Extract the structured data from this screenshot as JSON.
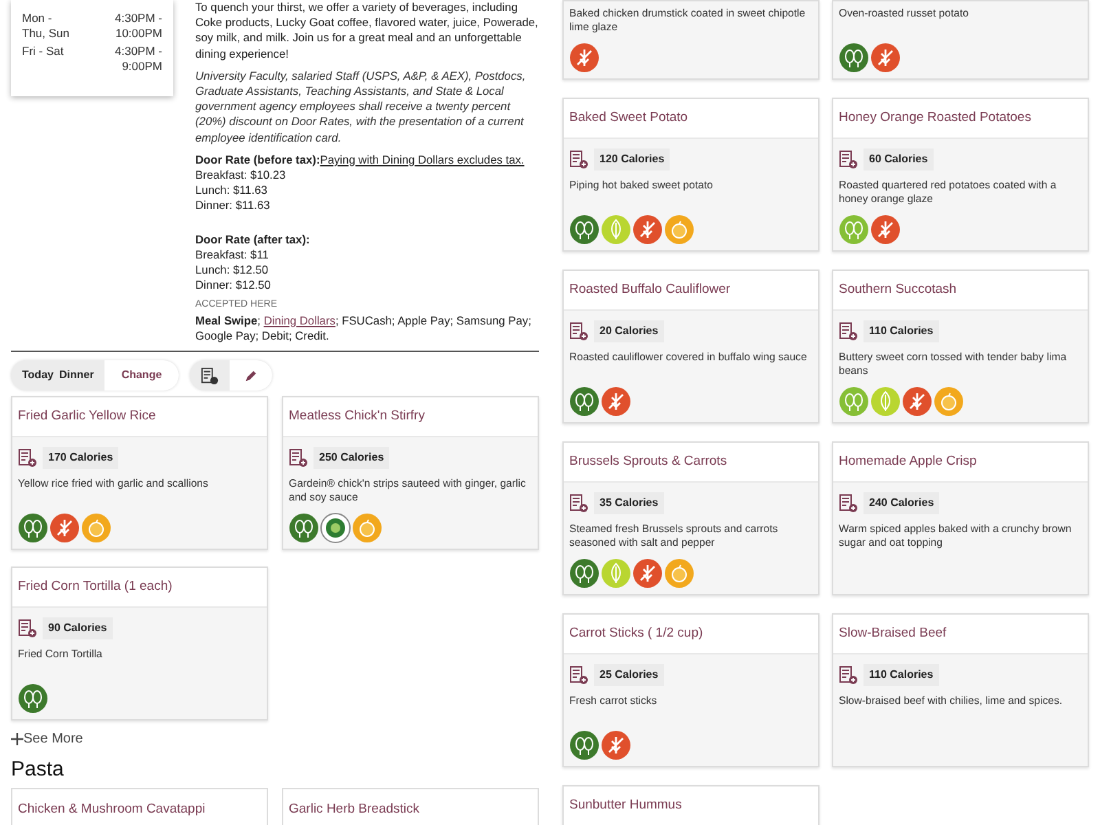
{
  "hours": [
    {
      "days": "Mon - Thu, Sun",
      "time": "4:30PM - 10:00PM"
    },
    {
      "days": "Fri - Sat",
      "time": "4:30PM - 9:00PM"
    }
  ],
  "about": {
    "intro": "To quench your thirst, we offer a variety of beverages, including Coke products, Lucky Goat coffee, flavored water, juice, Powerade, soy milk, and milk. Join us for a great meal and an unforgettable dining experience!",
    "discount": "University Faculty, salaried Staff (USPS, A&P, & AEX), Postdocs, Graduate Assistants, Teaching Assistants, and State & Local government agency employees shall receive a twenty percent (20%) discount on Door Rates, with the presentation of a current employee identification card.",
    "rates": [
      {
        "label": "Door Rate (before tax):",
        "link": "Paying with Dining Dollars excludes tax.",
        "lines": [
          "Breakfast: $10.23",
          "Lunch: $11.63",
          "Dinner: $11.63"
        ]
      },
      {
        "label": "Door Rate (after tax):",
        "lines": [
          "Breakfast: $11",
          "Lunch: $12.50",
          "Dinner: $12.50"
        ]
      }
    ],
    "accepted_heading": "ACCEPTED HERE",
    "accepted": {
      "prefix": "**Meal Swipe**; ",
      "link": "Dining Dollars",
      "suffix": "; FSUCash; Apple Pay; Samsung Pay; Google Pay; Debit; Credit."
    }
  },
  "toolbar": {
    "day": "Today",
    "meal": "Dinner",
    "change": "Change"
  },
  "left_items": [
    {
      "title": "Fried Garlic Yellow Rice",
      "calories": "170 Calories",
      "description": "Yellow rice fried with garlic and scallions",
      "badges": [
        {
          "kind": "vegan"
        },
        {
          "kind": "gluten-free"
        },
        {
          "kind": "fruit"
        }
      ]
    },
    {
      "title": "Meatless Chick'n Stirfry",
      "calories": "250 Calories",
      "description": "Gardein® chick'n strips sauteed with ginger, garlic and soy sauce",
      "badges": [
        {
          "kind": "vegan"
        },
        {
          "kind": "certified"
        },
        {
          "kind": "fruit"
        }
      ]
    },
    {
      "title": "Fried Corn Tortilla (1 each)",
      "calories": "90 Calories",
      "description": "Fried Corn Tortilla",
      "badges": [
        {
          "kind": "vegan"
        }
      ]
    }
  ],
  "see_more": "See More",
  "next_section": {
    "heading": "Pasta",
    "items": [
      "Chicken & Mushroom Cavatappi",
      "Garlic Herb Breadstick"
    ]
  },
  "right_items": [
    {
      "description": "Baked chicken drumstick coated in sweet chipotle lime glaze",
      "badges": [
        {
          "kind": "gluten-free"
        }
      ]
    },
    {
      "description": "Oven-roasted russet potato",
      "badges": [
        {
          "kind": "vegan"
        },
        {
          "kind": "gluten-free"
        }
      ]
    },
    {
      "title": "Baked Sweet Potato",
      "calories": "120 Calories",
      "description": "Piping hot baked sweet potato",
      "badges": [
        {
          "kind": "vegan"
        },
        {
          "kind": "plant"
        },
        {
          "kind": "gluten-free"
        },
        {
          "kind": "fruit"
        }
      ]
    },
    {
      "title": "Honey Orange Roasted Potatoes",
      "calories": "60 Calories",
      "description": "Roasted quartered red potatoes coated with a honey orange glaze",
      "badges": [
        {
          "kind": "vegetarian"
        },
        {
          "kind": "gluten-free"
        }
      ]
    },
    {
      "title": "Roasted Buffalo Cauliflower",
      "calories": "20 Calories",
      "description": "Roasted cauliflower covered in buffalo wing sauce",
      "badges": [
        {
          "kind": "vegan"
        },
        {
          "kind": "gluten-free"
        }
      ]
    },
    {
      "title": "Southern Succotash",
      "calories": "110 Calories",
      "description": "Buttery sweet corn tossed with tender baby lima beans",
      "badges": [
        {
          "kind": "vegetarian"
        },
        {
          "kind": "plant"
        },
        {
          "kind": "gluten-free"
        },
        {
          "kind": "fruit"
        }
      ]
    },
    {
      "title": "Brussels Sprouts & Carrots",
      "calories": "35 Calories",
      "description": "Steamed fresh Brussels sprouts and carrots seasoned with salt and pepper",
      "badges": [
        {
          "kind": "vegan"
        },
        {
          "kind": "plant"
        },
        {
          "kind": "gluten-free"
        },
        {
          "kind": "fruit"
        }
      ]
    },
    {
      "title": "Homemade Apple Crisp",
      "calories": "240 Calories",
      "description": "Warm spiced apples baked with a crunchy brown sugar and oat topping"
    },
    {
      "title": "Carrot Sticks ( 1/2 cup)",
      "calories": "25 Calories",
      "description": "Fresh carrot sticks",
      "badges": [
        {
          "kind": "vegan"
        },
        {
          "kind": "gluten-free"
        }
      ]
    },
    {
      "title": "Slow-Braised Beef",
      "calories": "110 Calories",
      "description": "Slow-braised beef with chilies, lime and spices."
    },
    {
      "title": "Sunbutter Hummus"
    }
  ]
}
